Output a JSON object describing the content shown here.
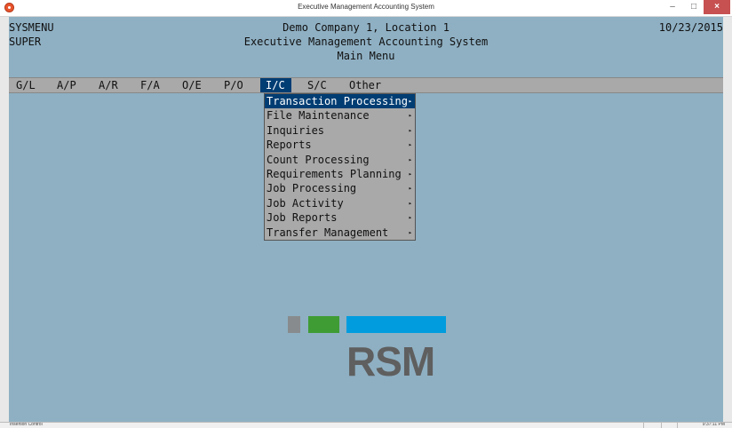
{
  "window": {
    "title": "Executive Management Accounting System",
    "minimize_label": "–",
    "maximize_label": "□",
    "close_label": "×"
  },
  "header": {
    "program": "SYSMENU",
    "user": "SUPER",
    "date": "10/23/2015",
    "company": "Demo Company 1, Location 1",
    "system_name": "Executive Management Accounting System",
    "screen_title": "Main Menu"
  },
  "menubar": {
    "items": [
      {
        "label": "G/L"
      },
      {
        "label": "A/P"
      },
      {
        "label": "A/R"
      },
      {
        "label": "F/A"
      },
      {
        "label": "O/E"
      },
      {
        "label": "P/O"
      },
      {
        "label": "I/C"
      },
      {
        "label": "S/C"
      },
      {
        "label": "Other"
      }
    ],
    "active": "I/C"
  },
  "dropdown": {
    "items": [
      {
        "label": "Transaction Processing"
      },
      {
        "label": "File Maintenance"
      },
      {
        "label": "Inquiries"
      },
      {
        "label": "Reports"
      },
      {
        "label": "Count Processing"
      },
      {
        "label": "Requirements Planning"
      },
      {
        "label": "Job Processing"
      },
      {
        "label": "Job Activity"
      },
      {
        "label": "Job Reports"
      },
      {
        "label": "Transfer Management"
      }
    ],
    "active_index": 0,
    "submenu_arrow": "▸"
  },
  "logo": {
    "text": "RSM",
    "colors": [
      "#888b8d",
      "#3f9c35",
      "#009cde"
    ]
  },
  "status": {
    "left": "Insertion Control",
    "right": "9:37:11 PM"
  },
  "colors": {
    "console_background": "#8fb0c3",
    "menu_background": "#a9a9a9",
    "highlight": "#003d73"
  }
}
